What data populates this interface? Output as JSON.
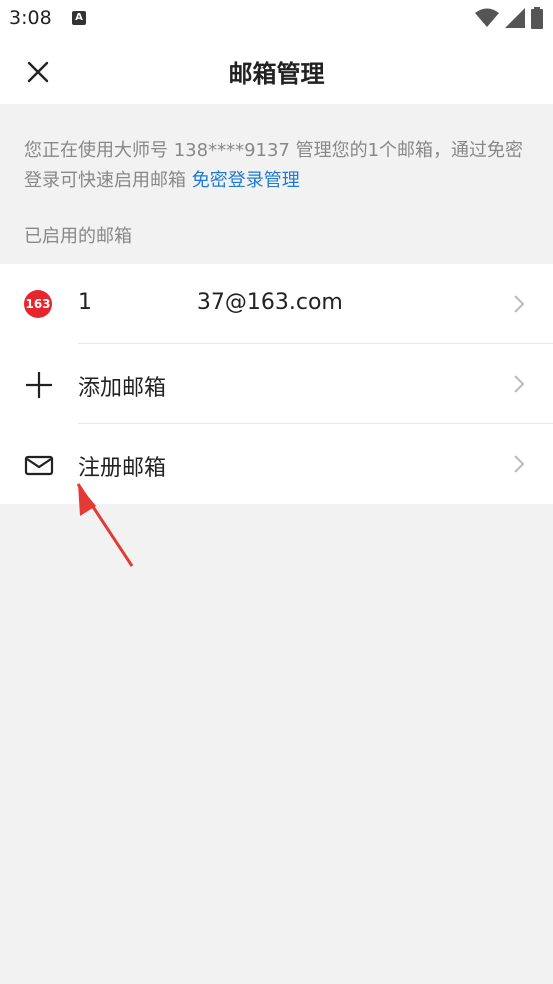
{
  "status": {
    "time": "3:08",
    "notif_letter": "A"
  },
  "header": {
    "title": "邮箱管理"
  },
  "info": {
    "text": "您正在使用大师号 138****9137 管理您的1个邮箱，通过免密登录可快速启用邮箱 ",
    "link": "免密登录管理"
  },
  "section": {
    "label": "已启用的邮箱"
  },
  "accounts": [
    {
      "badge": "163",
      "label": "1               37@163.com"
    }
  ],
  "actions": {
    "add_label": "添加邮箱",
    "register_label": "注册邮箱"
  },
  "colors": {
    "accent": "#1f7ad6",
    "badge": "#e8252c",
    "annotation": "#e53935"
  }
}
